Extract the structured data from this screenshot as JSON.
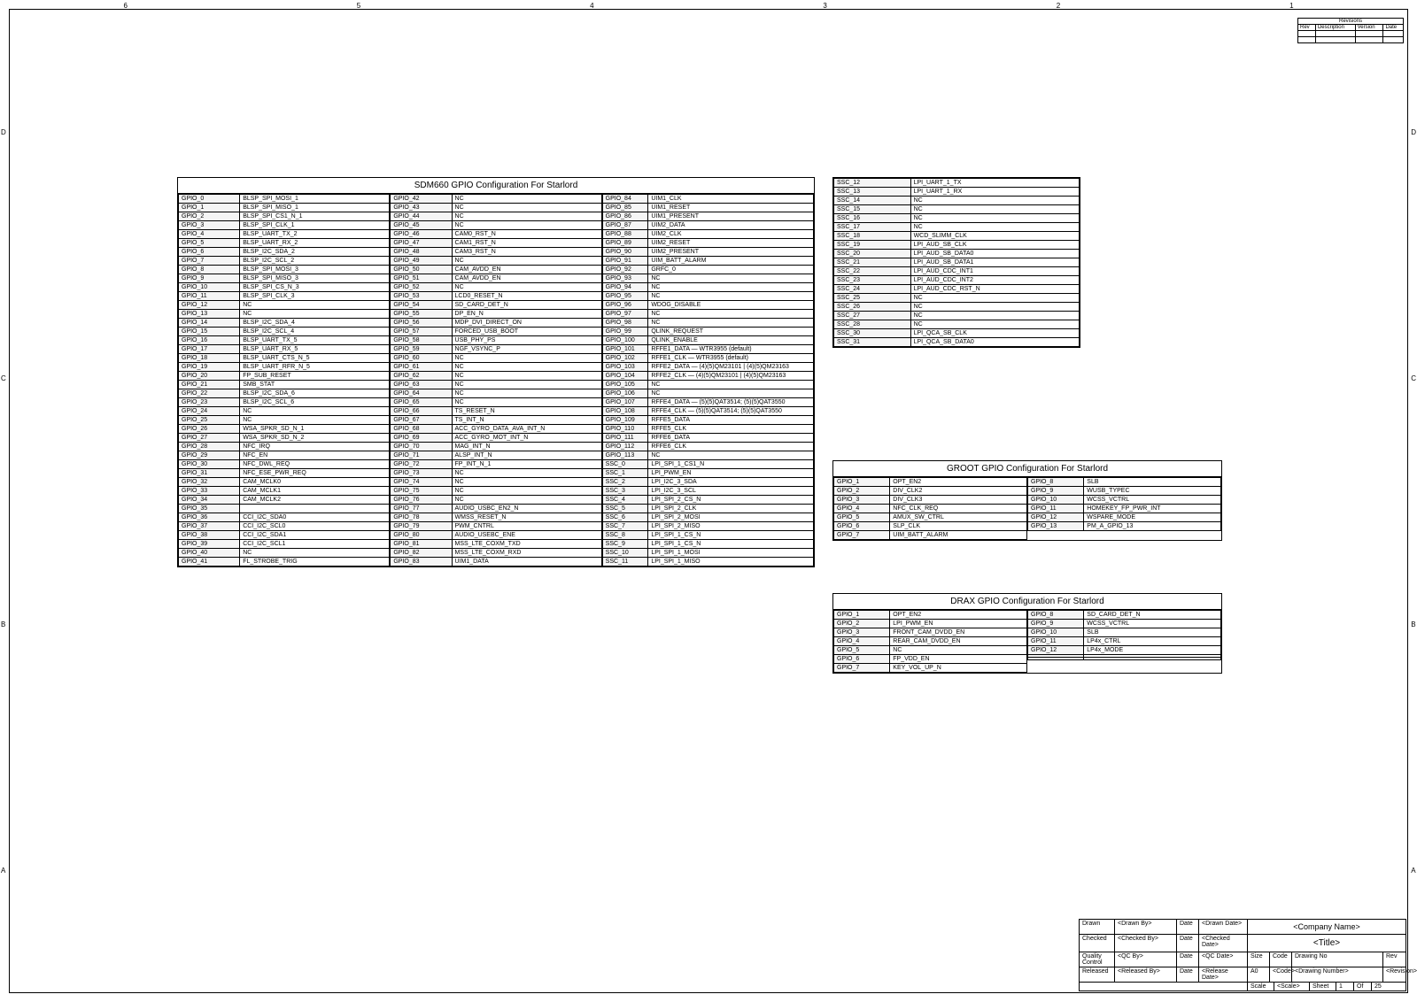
{
  "grid": {
    "cols": [
      "6",
      "5",
      "4",
      "3",
      "2",
      "1"
    ],
    "rows": [
      "D",
      "C",
      "B",
      "A"
    ]
  },
  "sdm660": {
    "title": "SDM660 GPIO Configuration For Starlord",
    "col1": [
      [
        "GPIO_0",
        "BLSP_SPI_MOSI_1"
      ],
      [
        "GPIO_1",
        "BLSP_SPI_MISO_1"
      ],
      [
        "GPIO_2",
        "BLSP_SPI_CS1_N_1"
      ],
      [
        "GPIO_3",
        "BLSP_SPI_CLK_1"
      ],
      [
        "GPIO_4",
        "BLSP_UART_TX_2"
      ],
      [
        "GPIO_5",
        "BLSP_UART_RX_2"
      ],
      [
        "GPIO_6",
        "BLSP_I2C_SDA_2"
      ],
      [
        "GPIO_7",
        "BLSP_I2C_SCL_2"
      ],
      [
        "GPIO_8",
        "BLSP_SPI_MOSI_3"
      ],
      [
        "GPIO_9",
        "BLSP_SPI_MISO_3"
      ],
      [
        "GPIO_10",
        "BLSP_SPI_CS_N_3"
      ],
      [
        "GPIO_11",
        "BLSP_SPI_CLK_3"
      ],
      [
        "GPIO_12",
        "NC"
      ],
      [
        "GPIO_13",
        "NC"
      ],
      [
        "GPIO_14",
        "BLSP_I2C_SDA_4"
      ],
      [
        "GPIO_15",
        "BLSP_I2C_SCL_4"
      ],
      [
        "GPIO_16",
        "BLSP_UART_TX_5"
      ],
      [
        "GPIO_17",
        "BLSP_UART_RX_5"
      ],
      [
        "GPIO_18",
        "BLSP_UART_CTS_N_5"
      ],
      [
        "GPIO_19",
        "BLSP_UART_RFR_N_5"
      ],
      [
        "GPIO_20",
        "FP_SUB_RESET"
      ],
      [
        "GPIO_21",
        "SMB_STAT"
      ],
      [
        "GPIO_22",
        "BLSP_I2C_SDA_6"
      ],
      [
        "GPIO_23",
        "BLSP_I2C_SCL_6"
      ],
      [
        "GPIO_24",
        "NC"
      ],
      [
        "GPIO_25",
        "NC"
      ],
      [
        "GPIO_26",
        "WSA_SPKR_SD_N_1"
      ],
      [
        "GPIO_27",
        "WSA_SPKR_SD_N_2"
      ],
      [
        "GPIO_28",
        "NFC_IRQ"
      ],
      [
        "GPIO_29",
        "NFC_EN"
      ],
      [
        "GPIO_30",
        "NFC_DWL_REQ"
      ],
      [
        "GPIO_31",
        "NFC_ESE_PWR_REQ"
      ],
      [
        "GPIO_32",
        "CAM_MCLK0"
      ],
      [
        "GPIO_33",
        "CAM_MCLK1"
      ],
      [
        "GPIO_34",
        "CAM_MCLK2"
      ],
      [
        "GPIO_35",
        ""
      ],
      [
        "GPIO_36",
        "CCI_I2C_SDA0"
      ],
      [
        "GPIO_37",
        "CCI_I2C_SCL0"
      ],
      [
        "GPIO_38",
        "CCI_I2C_SDA1"
      ],
      [
        "GPIO_39",
        "CCI_I2C_SCL1"
      ],
      [
        "GPIO_40",
        "NC"
      ],
      [
        "GPIO_41",
        "FL_STROBE_TRIG"
      ]
    ],
    "col2": [
      [
        "GPIO_42",
        "NC"
      ],
      [
        "GPIO_43",
        "NC"
      ],
      [
        "GPIO_44",
        "NC"
      ],
      [
        "GPIO_45",
        "NC"
      ],
      [
        "GPIO_46",
        "CAM0_RST_N"
      ],
      [
        "GPIO_47",
        "CAM1_RST_N"
      ],
      [
        "GPIO_48",
        "CAM3_RST_N"
      ],
      [
        "GPIO_49",
        "NC"
      ],
      [
        "GPIO_50",
        "CAM_AVDD_EN"
      ],
      [
        "GPIO_51",
        "CAM_AVDD_EN"
      ],
      [
        "GPIO_52",
        "NC"
      ],
      [
        "GPIO_53",
        "LCD0_RESET_N"
      ],
      [
        "GPIO_54",
        "SD_CARD_DET_N"
      ],
      [
        "GPIO_55",
        "DP_EN_N"
      ],
      [
        "GPIO_56",
        "MDP_DVI_DIRECT_ON"
      ],
      [
        "GPIO_57",
        "FORCED_USB_BOOT"
      ],
      [
        "GPIO_58",
        "USB_PHY_PS"
      ],
      [
        "GPIO_59",
        "NGF_VSYNC_P"
      ],
      [
        "GPIO_60",
        "NC"
      ],
      [
        "GPIO_61",
        "NC"
      ],
      [
        "GPIO_62",
        "NC"
      ],
      [
        "GPIO_63",
        "NC"
      ],
      [
        "GPIO_64",
        "NC"
      ],
      [
        "GPIO_65",
        "NC"
      ],
      [
        "GPIO_66",
        "TS_RESET_N"
      ],
      [
        "GPIO_67",
        "TS_INT_N"
      ],
      [
        "GPIO_68",
        "ACC_GYRO_DATA_AVA_INT_N"
      ],
      [
        "GPIO_69",
        "ACC_GYRO_MOT_INT_N"
      ],
      [
        "GPIO_70",
        "MAG_INT_N"
      ],
      [
        "GPIO_71",
        "ALSP_INT_N"
      ],
      [
        "GPIO_72",
        "FP_INT_N_1"
      ],
      [
        "GPIO_73",
        "NC"
      ],
      [
        "GPIO_74",
        "NC"
      ],
      [
        "GPIO_75",
        "NC"
      ],
      [
        "GPIO_76",
        "NC"
      ],
      [
        "GPIO_77",
        "AUDIO_USBC_EN2_N"
      ],
      [
        "GPIO_78",
        "WMSS_RESET_N"
      ],
      [
        "GPIO_79",
        "PWM_CNTRL"
      ],
      [
        "GPIO_80",
        "AUDIO_USEBC_ENE"
      ],
      [
        "GPIO_81",
        "MSS_LTE_COXM_TXD"
      ],
      [
        "GPIO_82",
        "MSS_LTE_COXM_RXD"
      ],
      [
        "GPIO_83",
        "UIM1_DATA"
      ]
    ],
    "col3": [
      [
        "GPIO_84",
        "UIM1_CLK"
      ],
      [
        "GPIO_85",
        "UIM1_RESET"
      ],
      [
        "GPIO_86",
        "UIM1_PRESENT"
      ],
      [
        "GPIO_87",
        "UIM2_DATA"
      ],
      [
        "GPIO_88",
        "UIM2_CLK"
      ],
      [
        "GPIO_89",
        "UIM2_RESET"
      ],
      [
        "GPIO_90",
        "UIM2_PRESENT"
      ],
      [
        "GPIO_91",
        "UIM_BATT_ALARM"
      ],
      [
        "GPIO_92",
        "GRFC_0"
      ],
      [
        "GPIO_93",
        "NC"
      ],
      [
        "GPIO_94",
        "NC"
      ],
      [
        "GPIO_95",
        "NC"
      ],
      [
        "GPIO_96",
        "WDOG_DISABLE"
      ],
      [
        "GPIO_97",
        "NC"
      ],
      [
        "GPIO_98",
        "NC"
      ],
      [
        "GPIO_99",
        "QLINK_REQUEST"
      ],
      [
        "GPIO_100",
        "QLINK_ENABLE"
      ],
      [
        "GPIO_101",
        "RFFE1_DATA — WTR3955 (default)"
      ],
      [
        "GPIO_102",
        "RFFE1_CLK — WTR3955 (default)"
      ],
      [
        "GPIO_103",
        "RFFE2_DATA — (4)(5)QM23101 | (4)(5)QM23163"
      ],
      [
        "GPIO_104",
        "RFFE2_CLK — (4)(5)QM23101 | (4)(5)QM23163"
      ],
      [
        "GPIO_105",
        "NC"
      ],
      [
        "GPIO_106",
        "NC"
      ],
      [
        "GPIO_107",
        "RFFE4_DATA — (5)(5)QAT3514; (5)(5)QAT3550"
      ],
      [
        "GPIO_108",
        "RFFE4_CLK — (5)(5)QAT3514; (5)(5)QAT3550"
      ],
      [
        "GPIO_109",
        "RFFE5_DATA"
      ],
      [
        "GPIO_110",
        "RFFE5_CLK"
      ],
      [
        "GPIO_111",
        "RFFE6_DATA"
      ],
      [
        "GPIO_112",
        "RFFE6_CLK"
      ],
      [
        "GPIO_113",
        "NC"
      ],
      [
        "SSC_0",
        "LPI_SPI_1_CS1_N"
      ],
      [
        "SSC_1",
        "LPI_PWM_EN"
      ],
      [
        "SSC_2",
        "LPI_I2C_3_SDA"
      ],
      [
        "SSC_3",
        "LPI_I2C_3_SCL"
      ],
      [
        "SSC_4",
        "LPI_SPI_2_CS_N"
      ],
      [
        "SSC_5",
        "LPI_SPI_2_CLK"
      ],
      [
        "SSC_6",
        "LPI_SPI_2_MOSI"
      ],
      [
        "SSC_7",
        "LPI_SPI_2_MISO"
      ],
      [
        "SSC_8",
        "LPI_SPI_1_CS_N"
      ],
      [
        "SSC_9",
        "LPI_SPI_1_CS_N"
      ],
      [
        "SSC_10",
        "LPI_SPI_1_MOSI"
      ],
      [
        "SSC_11",
        "LPI_SPI_1_MISO"
      ]
    ]
  },
  "ssc": [
    [
      "SSC_12",
      "LPI_UART_1_TX"
    ],
    [
      "SSC_13",
      "LPI_UART_1_RX"
    ],
    [
      "SSC_14",
      "NC"
    ],
    [
      "SSC_15",
      "NC"
    ],
    [
      "SSC_16",
      "NC"
    ],
    [
      "SSC_17",
      "NC"
    ],
    [
      "SSC_18",
      "WCD_SLIMM_CLK"
    ],
    [
      "SSC_19",
      "LPI_AUD_SB_CLK"
    ],
    [
      "SSC_20",
      "LPI_AUD_SB_DATA0"
    ],
    [
      "SSC_21",
      "LPI_AUD_SB_DATA1"
    ],
    [
      "SSC_22",
      "LPI_AUD_CDC_INT1"
    ],
    [
      "SSC_23",
      "LPI_AUD_CDC_INT2"
    ],
    [
      "SSC_24",
      "LPI_AUD_CDC_RST_N"
    ],
    [
      "SSC_25",
      "NC"
    ],
    [
      "SSC_26",
      "NC"
    ],
    [
      "SSC_27",
      "NC"
    ],
    [
      "SSC_28",
      "NC"
    ],
    [
      "SSC_30",
      "LPI_QCA_SB_CLK"
    ],
    [
      "SSC_31",
      "LPI_QCA_SB_DATA0"
    ]
  ],
  "groot": {
    "title": "GROOT GPIO Configuration For Starlord",
    "col1": [
      [
        "GPIO_1",
        "OPT_EN2"
      ],
      [
        "GPIO_2",
        "DIV_CLK2"
      ],
      [
        "GPIO_3",
        "DIV_CLK3"
      ],
      [
        "GPIO_4",
        "NFC_CLK_REQ"
      ],
      [
        "GPIO_5",
        "AMUX_SW_CTRL"
      ],
      [
        "GPIO_6",
        "SLP_CLK"
      ],
      [
        "GPIO_7",
        "UIM_BATT_ALARM"
      ]
    ],
    "col2": [
      [
        "GPIO_8",
        "SLB"
      ],
      [
        "GPIO_9",
        "WUSB_TYPEC"
      ],
      [
        "GPIO_10",
        "WCSS_VCTRL"
      ],
      [
        "GPIO_11",
        "HOMEKEY_FP_PWR_INT"
      ],
      [
        "GPIO_12",
        "WSPARE_MODE"
      ],
      [
        "GPIO_13",
        "PM_A_GPIO_13"
      ]
    ]
  },
  "drax": {
    "title": "DRAX GPIO Configuration For Starlord",
    "col1": [
      [
        "GPIO_1",
        "OPT_EN2"
      ],
      [
        "GPIO_2",
        "LPI_PWM_EN"
      ],
      [
        "GPIO_3",
        "FRONT_CAM_DVDD_EN"
      ],
      [
        "GPIO_4",
        "REAR_CAM_DVDD_EN"
      ],
      [
        "GPIO_5",
        "NC"
      ],
      [
        "GPIO_6",
        "FP_VDD_EN"
      ],
      [
        "GPIO_7",
        "KEY_VOL_UP_N"
      ]
    ],
    "col2": [
      [
        "GPIO_8",
        "SD_CARD_DET_N"
      ],
      [
        "GPIO_9",
        "WCSS_VCTRL"
      ],
      [
        "GPIO_10",
        "SLB"
      ],
      [
        "GPIO_11",
        "LP4x_CTRL"
      ],
      [
        "GPIO_12",
        "LP4x_MODE"
      ],
      [
        "",
        ""
      ],
      [
        "",
        ""
      ]
    ]
  },
  "rev": {
    "header": [
      "Rev",
      "Description",
      "Version",
      "Date"
    ]
  },
  "titleblock": {
    "company": "<Company Name>",
    "title": "<Title>",
    "drawn": "<Drawn By>",
    "checked": "<Checked By>",
    "qc": "<QC By>",
    "released": "<Released By>",
    "code": "<Code>",
    "size": "A0",
    "dwg": "<Drawing Number>",
    "revlbl": "<Revision>",
    "date1": "<Drawn Date>",
    "date2": "<Checked Date>",
    "date3": "<QC Date>",
    "date4": "<Release Date>",
    "scale": "<Scale>",
    "sheet": "1",
    "of": "25",
    "lbl_drawn": "Drawn",
    "lbl_checked": "Checked",
    "lbl_qc": "Quality Control",
    "lbl_released": "Released",
    "lbl_size": "Size",
    "lbl_code": "Code",
    "lbl_dwg": "Drawing No",
    "lbl_rev": "Rev",
    "lbl_scale": "Scale",
    "lbl_sheet": "Sheet",
    "lbl_of": "Of",
    "lbl_date": "Date"
  }
}
